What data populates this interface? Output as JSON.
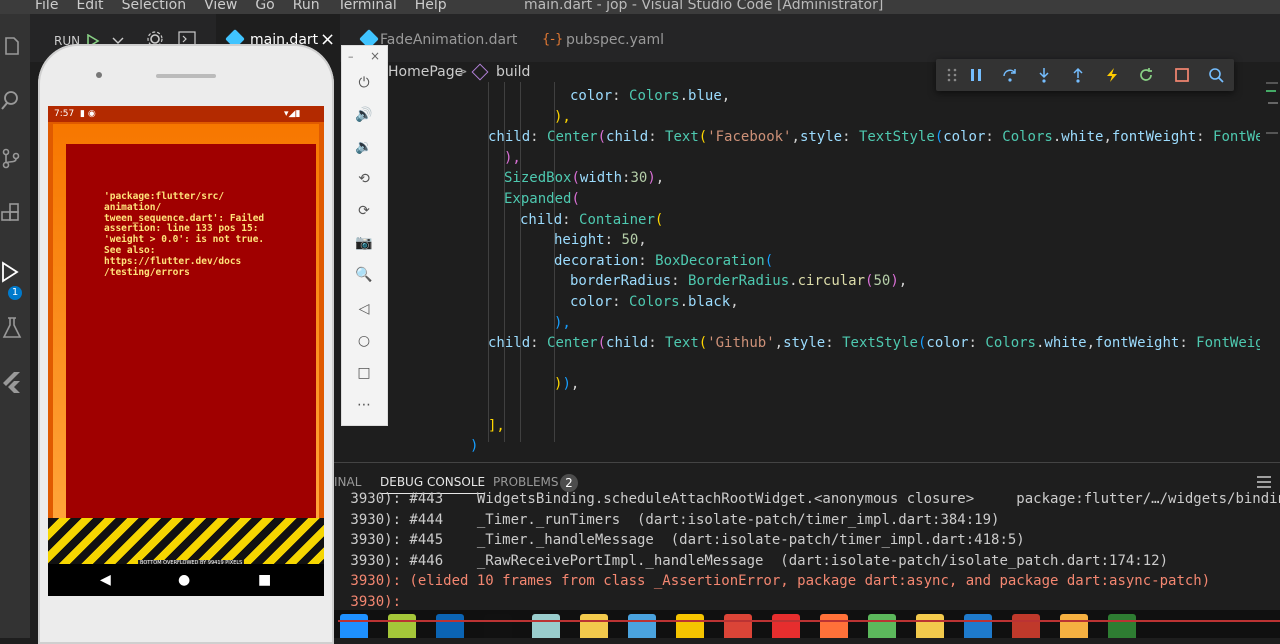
{
  "window": {
    "menu": [
      "File",
      "Edit",
      "Selection",
      "View",
      "Go",
      "Run",
      "Terminal",
      "Help"
    ],
    "title": "main.dart - jop - Visual Studio Code [Administrator]"
  },
  "activity": {
    "badge": "1"
  },
  "run": {
    "label": "RUN"
  },
  "tabs": [
    {
      "label": "main.dart",
      "close": "×"
    },
    {
      "label": "FadeAnimation.dart"
    },
    {
      "label": "pubspec.yaml"
    }
  ],
  "breadcrumb": {
    "parent": "HomePage",
    "sep": ">",
    "current": "build"
  },
  "code": [
    {
      "indent": 184,
      "tokens": [
        [
          "k",
          "color"
        ],
        [
          "p",
          ": "
        ],
        [
          "c",
          "Colors"
        ],
        [
          "p",
          "."
        ],
        [
          "k",
          "blue"
        ],
        [
          "p",
          ","
        ]
      ]
    },
    {
      "indent": 168,
      "tokens": [
        [
          "y",
          "),"
        ]
      ]
    },
    {
      "indent": 102,
      "tokens": [
        [
          "k",
          "child"
        ],
        [
          "p",
          ": "
        ],
        [
          "c",
          "Center"
        ],
        [
          "pu",
          "("
        ],
        [
          "k",
          "child"
        ],
        [
          "p",
          ": "
        ],
        [
          "c",
          "Text"
        ],
        [
          "y",
          "("
        ],
        [
          "s",
          "'Facebook'"
        ],
        [
          "p",
          ","
        ],
        [
          "k",
          "style"
        ],
        [
          "p",
          ": "
        ],
        [
          "c",
          "TextStyle"
        ],
        [
          "bl",
          "("
        ],
        [
          "k",
          "color"
        ],
        [
          "p",
          ": "
        ],
        [
          "c",
          "Colors"
        ],
        [
          "p",
          "."
        ],
        [
          "k",
          "white"
        ],
        [
          "p",
          ","
        ],
        [
          "k",
          "fontWeight"
        ],
        [
          "p",
          ": "
        ],
        [
          "c",
          "FontWei"
        ]
      ]
    },
    {
      "indent": 118,
      "tokens": [
        [
          "pu",
          "),"
        ]
      ]
    },
    {
      "indent": 118,
      "tokens": [
        [
          "c",
          "SizedBox"
        ],
        [
          "pu",
          "("
        ],
        [
          "k",
          "width"
        ],
        [
          "p",
          ":"
        ],
        [
          "n",
          "30"
        ],
        [
          "pu",
          ")"
        ],
        [
          "p",
          ","
        ]
      ]
    },
    {
      "indent": 118,
      "tokens": [
        [
          "c",
          "Expanded"
        ],
        [
          "pu",
          "("
        ]
      ]
    },
    {
      "indent": 134,
      "tokens": [
        [
          "k",
          "child"
        ],
        [
          "p",
          ": "
        ],
        [
          "c",
          "Container"
        ],
        [
          "y",
          "("
        ]
      ]
    },
    {
      "indent": 168,
      "tokens": [
        [
          "k",
          "height"
        ],
        [
          "p",
          ": "
        ],
        [
          "n",
          "50"
        ],
        [
          "p",
          ","
        ]
      ]
    },
    {
      "indent": 168,
      "tokens": [
        [
          "k",
          "decoration"
        ],
        [
          "p",
          ": "
        ],
        [
          "c",
          "BoxDecoration"
        ],
        [
          "bl",
          "("
        ]
      ]
    },
    {
      "indent": 184,
      "tokens": [
        [
          "k",
          "borderRadius"
        ],
        [
          "p",
          ": "
        ],
        [
          "c",
          "BorderRadius"
        ],
        [
          "p",
          "."
        ],
        [
          "f",
          "circular"
        ],
        [
          "pu",
          "("
        ],
        [
          "n",
          "50"
        ],
        [
          "pu",
          ")"
        ],
        [
          "p",
          ","
        ]
      ]
    },
    {
      "indent": 184,
      "tokens": [
        [
          "k",
          "color"
        ],
        [
          "p",
          ": "
        ],
        [
          "c",
          "Colors"
        ],
        [
          "p",
          "."
        ],
        [
          "k",
          "black"
        ],
        [
          "p",
          ","
        ]
      ]
    },
    {
      "indent": 168,
      "tokens": [
        [
          "bl",
          "),"
        ]
      ]
    },
    {
      "indent": 102,
      "tokens": [
        [
          "k",
          "child"
        ],
        [
          "p",
          ": "
        ],
        [
          "c",
          "Center"
        ],
        [
          "pu",
          "("
        ],
        [
          "k",
          "child"
        ],
        [
          "p",
          ": "
        ],
        [
          "c",
          "Text"
        ],
        [
          "y",
          "("
        ],
        [
          "s",
          "'Github'"
        ],
        [
          "p",
          ","
        ],
        [
          "k",
          "style"
        ],
        [
          "p",
          ": "
        ],
        [
          "c",
          "TextStyle"
        ],
        [
          "bl",
          "("
        ],
        [
          "k",
          "color"
        ],
        [
          "p",
          ": "
        ],
        [
          "c",
          "Colors"
        ],
        [
          "p",
          "."
        ],
        [
          "k",
          "white"
        ],
        [
          "p",
          ","
        ],
        [
          "k",
          "fontWeight"
        ],
        [
          "p",
          ": "
        ],
        [
          "c",
          "FontWeigh"
        ]
      ]
    },
    {
      "indent": 0,
      "tokens": []
    },
    {
      "indent": 168,
      "tokens": [
        [
          "y",
          ")"
        ],
        [
          "bl",
          ")"
        ],
        [
          "p",
          ","
        ]
      ]
    },
    {
      "indent": 0,
      "tokens": []
    },
    {
      "indent": 102,
      "tokens": [
        [
          "y",
          "],"
        ]
      ]
    },
    {
      "indent": 84,
      "tokens": [
        [
          "bl",
          ")"
        ]
      ]
    }
  ],
  "panel": {
    "tabs": [
      "INAL",
      "DEBUG CONSOLE",
      "PROBLEMS"
    ],
    "problems_count": "2",
    "lines": [
      {
        "text": " 3930): #443    WidgetsBinding.scheduleAttachRootWidget.<anonymous closure>     package:flutter/…/widgets/binding.",
        "err": false
      },
      {
        "text": " 3930): #444    _Timer._runTimers  (dart:isolate-patch/timer_impl.dart:384:19)",
        "err": false
      },
      {
        "text": " 3930): #445    _Timer._handleMessage  (dart:isolate-patch/timer_impl.dart:418:5)",
        "err": false
      },
      {
        "text": " 3930): #446    _RawReceivePortImpl._handleMessage  (dart:isolate-patch/isolate_patch.dart:174:12)",
        "err": false
      },
      {
        "text": " 3930): (elided 10 frames from class _AssertionError, package dart:async, and package dart:async-patch)",
        "err": true
      },
      {
        "text": " 3930):",
        "err": true
      },
      {
        "text": " 3930):",
        "err": false
      }
    ]
  },
  "phone": {
    "time": "7:57",
    "error_text": "'package:flutter/src/\nanimation/\ntween_sequence.dart': Failed\nassertion: line 133 pos 15:\n'weight > 0.0': is not true.\nSee also:\nhttps://flutter.dev/docs\n/testing/errors",
    "overflow_text": "BOTTOM OVERFLOWED BY 99419 PIXELS",
    "nav": [
      "◀",
      "●",
      "■"
    ]
  },
  "taskbar_icons": [
    "windows",
    "android-studio",
    "photoshop",
    "nexus",
    "recycle-bin",
    "folder",
    "notepad",
    "media-player",
    "chrome",
    "yandex",
    "firefox",
    "paint",
    "file-explorer",
    "vscode",
    "tool",
    "naruto",
    "game"
  ],
  "colors": {
    "editor_bg": "#1e1e1e",
    "error_red": "#a00000",
    "accent": "#007acc"
  }
}
